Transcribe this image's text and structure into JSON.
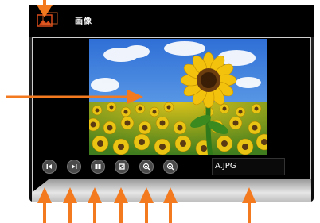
{
  "window": {
    "title": "画像",
    "app_icon": "photo-app-icon"
  },
  "viewer": {
    "image_subject": "sunflower-field"
  },
  "controls": [
    {
      "id": "previous",
      "icon": "previous-icon"
    },
    {
      "id": "next",
      "icon": "next-icon"
    },
    {
      "id": "slideshow",
      "icon": "slideshow-icon"
    },
    {
      "id": "rotate",
      "icon": "rotate-icon"
    },
    {
      "id": "zoom-in",
      "icon": "zoom-in-icon"
    },
    {
      "id": "zoom-out",
      "icon": "zoom-out-icon"
    }
  ],
  "file": {
    "name": "A.JPG"
  },
  "colors": {
    "callout_arrow": "#f47a20",
    "title_bar": "#000000",
    "control_button": "#4a4a4a"
  }
}
